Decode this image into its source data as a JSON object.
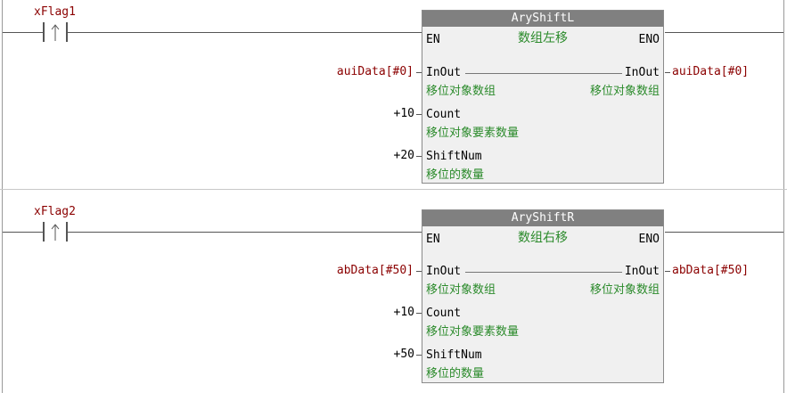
{
  "rungs": [
    {
      "contact": "xFlag1",
      "block": {
        "type": "AryShiftL",
        "description": "数组左移",
        "en": "EN",
        "eno": "ENO",
        "inout_in": "InOut",
        "inout_out": "InOut",
        "inout_comment": "移位对象数组",
        "inout_out_comment": "移位对象数组",
        "count_pin": "Count",
        "count_comment": "移位对象要素数量",
        "shift_pin": "ShiftNum",
        "shift_comment": "移位的数量"
      },
      "input_var": "auiData[#0]",
      "output_var": "auiData[#0]",
      "count_value": "+10",
      "shift_value": "+20"
    },
    {
      "contact": "xFlag2",
      "block": {
        "type": "AryShiftR",
        "description": "数组右移",
        "en": "EN",
        "eno": "ENO",
        "inout_in": "InOut",
        "inout_out": "InOut",
        "inout_comment": "移位对象数组",
        "inout_out_comment": "移位对象数组",
        "count_pin": "Count",
        "count_comment": "移位对象要素数量",
        "shift_pin": "ShiftNum",
        "shift_comment": "移位的数量"
      },
      "input_var": "abData[#50]",
      "output_var": "abData[#50]",
      "count_value": "+10",
      "shift_value": "+50"
    }
  ],
  "colors": {
    "variable": "#8b0000",
    "comment": "#2a8a2a",
    "block_title_bg": "#808080",
    "block_bg": "#f0f0f0"
  }
}
